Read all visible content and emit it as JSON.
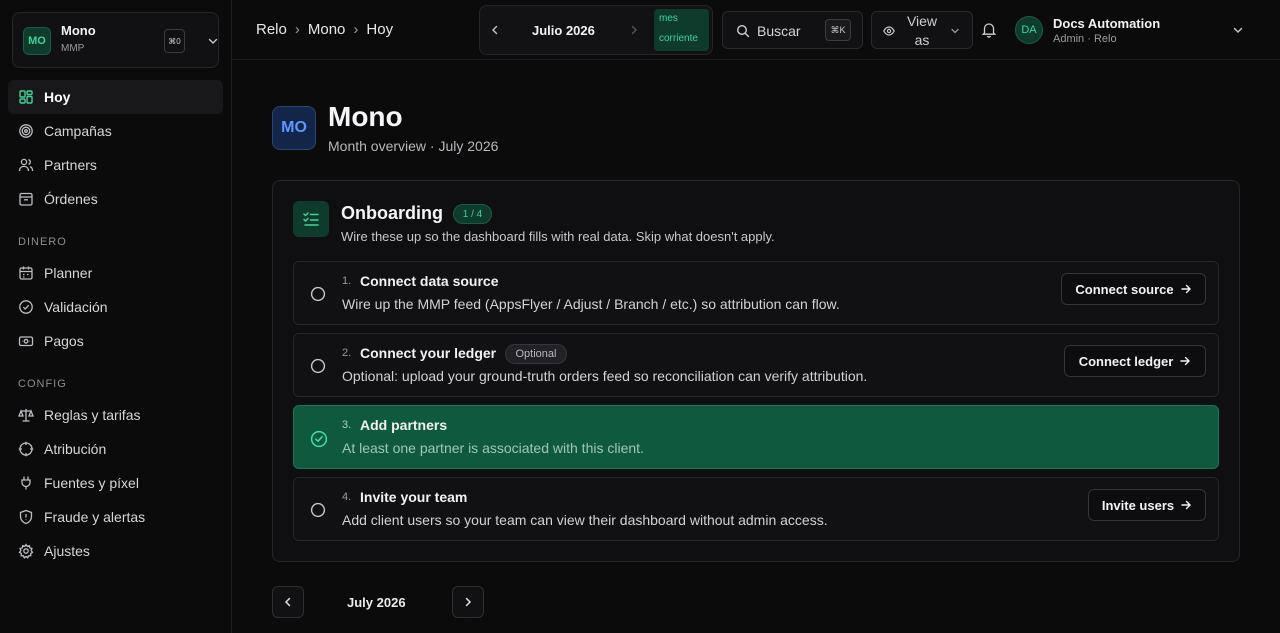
{
  "workspace": {
    "avatar": "MO",
    "name": "Mono",
    "sub": "MMP",
    "kbd": "⌘0"
  },
  "sidebar": {
    "main": [
      {
        "label": "Hoy",
        "icon": "dashboard-icon",
        "active": true
      },
      {
        "label": "Campañas",
        "icon": "target-icon"
      },
      {
        "label": "Partners",
        "icon": "users-icon"
      },
      {
        "label": "Órdenes",
        "icon": "box-icon"
      }
    ],
    "dinero_title": "DINERO",
    "dinero": [
      {
        "label": "Planner",
        "icon": "calendar-icon"
      },
      {
        "label": "Validación",
        "icon": "check-circle-icon"
      },
      {
        "label": "Pagos",
        "icon": "banknote-icon"
      }
    ],
    "config_title": "CONFIG",
    "config": [
      {
        "label": "Reglas y tarifas",
        "icon": "scale-icon"
      },
      {
        "label": "Atribución",
        "icon": "crosshair-icon"
      },
      {
        "label": "Fuentes y píxel",
        "icon": "plug-icon"
      },
      {
        "label": "Fraude y alertas",
        "icon": "shield-icon"
      },
      {
        "label": "Ajustes",
        "icon": "gear-icon"
      }
    ]
  },
  "header": {
    "breadcrumb": [
      "Relo",
      "Mono",
      "Hoy"
    ],
    "month": {
      "label": "Julio 2026",
      "badge_line1": "mes",
      "badge_line2": "corriente"
    },
    "search": {
      "label": "Buscar",
      "kbd": "⌘K"
    },
    "view_as": {
      "line1": "View",
      "line2": "as"
    },
    "user": {
      "avatar": "DA",
      "name": "Docs Automation",
      "role": "Admin · Relo"
    }
  },
  "page": {
    "avatar": "MO",
    "title": "Mono",
    "subtitle": "Month overview · July 2026"
  },
  "onboarding": {
    "title": "Onboarding",
    "progress": "1 / 4",
    "description": "Wire these up so the dashboard fills with real data. Skip what doesn't apply.",
    "steps": [
      {
        "num": "1.",
        "title": "Connect data source",
        "desc": "Wire up the MMP feed (AppsFlyer / Adjust / Branch / etc.) so attribution can flow.",
        "button": "Connect source",
        "done": false
      },
      {
        "num": "2.",
        "title": "Connect your ledger",
        "tag": "Optional",
        "desc": "Optional: upload your ground-truth orders feed so reconciliation can verify attribution.",
        "button": "Connect ledger",
        "done": false
      },
      {
        "num": "3.",
        "title": "Add partners",
        "desc": "At least one partner is associated with this client.",
        "done": true
      },
      {
        "num": "4.",
        "title": "Invite your team",
        "desc": "Add client users so your team can view their dashboard without admin access.",
        "button": "Invite users",
        "done": false
      }
    ]
  },
  "pager": {
    "label": "July 2026"
  },
  "colors": {
    "accent": "#3fd39a",
    "done_bg": "#0f5a3e",
    "background": "#0b0b0c"
  }
}
